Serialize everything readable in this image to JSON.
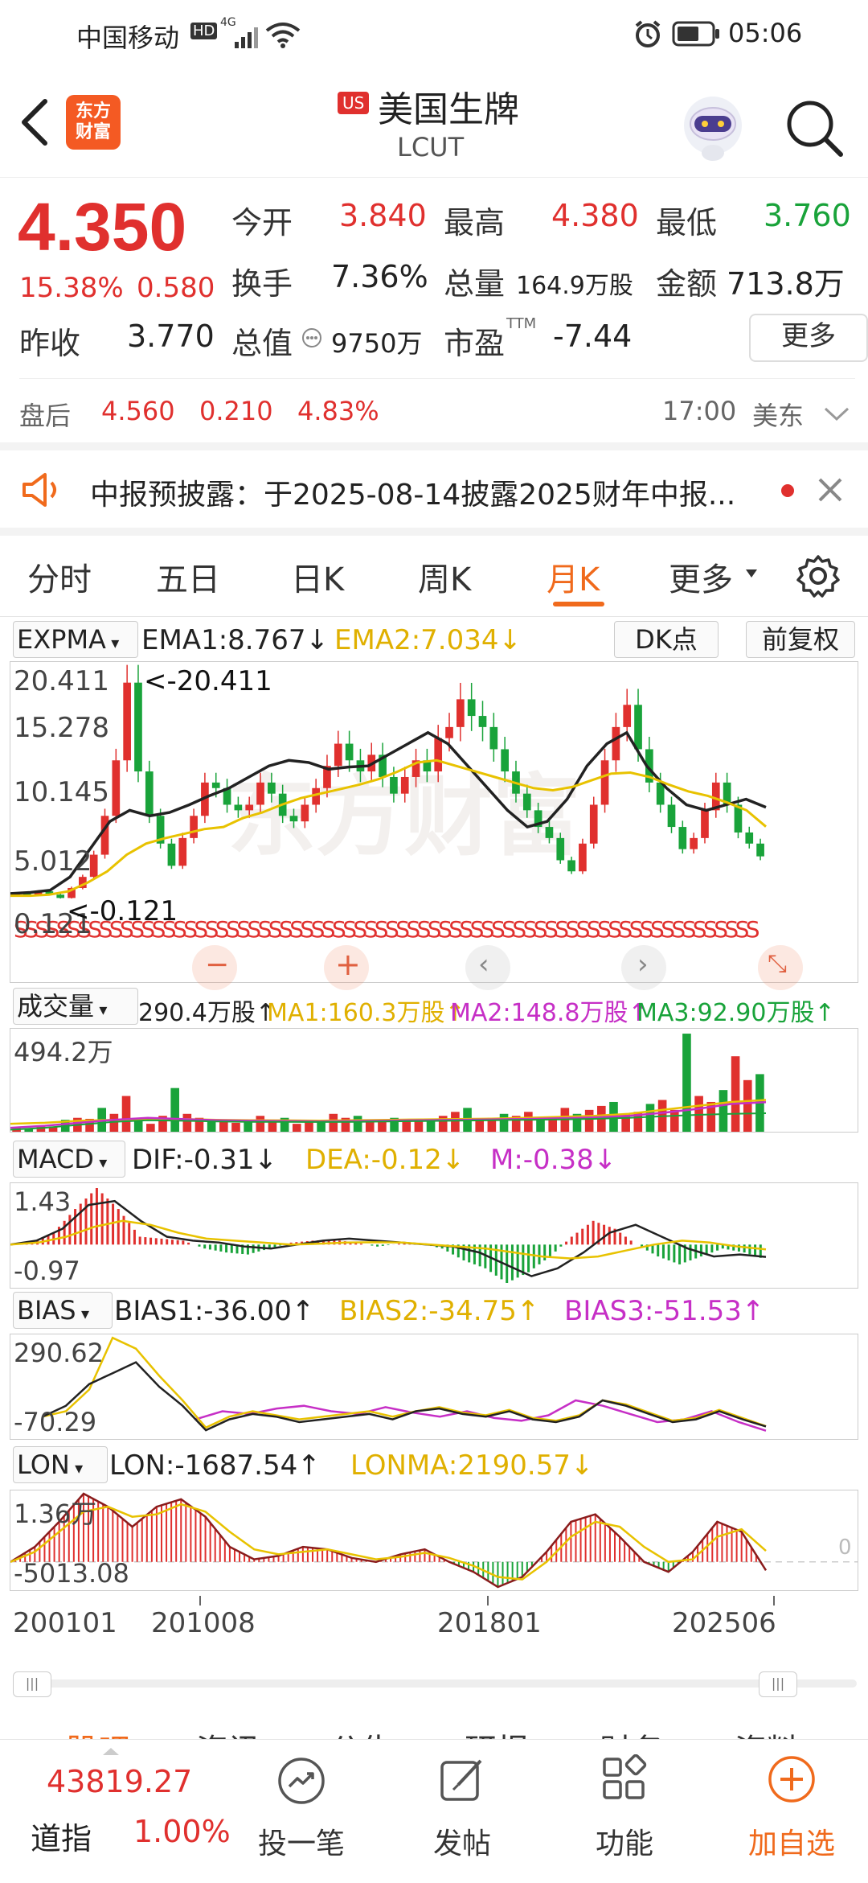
{
  "status_bar": {
    "carrier": "中国移动",
    "hd": "HD",
    "network": "4G",
    "time": "05:06"
  },
  "header": {
    "back_icon": "chevron-left-icon",
    "app_logo_line1": "东方",
    "app_logo_line2": "财富",
    "market_tag": "US",
    "stock_name": "美国生牌",
    "ticker": "LCUT"
  },
  "quote": {
    "price": "4.350",
    "change_pct": "15.38%",
    "change": "0.580",
    "open_label": "今开",
    "open": "3.840",
    "high_label": "最高",
    "high": "4.380",
    "low_label": "最低",
    "low": "3.760",
    "turnover_label": "换手",
    "turnover": "7.36%",
    "volume_label": "总量",
    "volume": "164.9万股",
    "amount_label": "金额",
    "amount": "713.8万",
    "prev_close_label": "昨收",
    "prev_close": "3.770",
    "mktcap_label": "总值",
    "mktcap": "9750万",
    "pe_label": "市盈",
    "pe_sup": "TTM",
    "pe": "-7.44",
    "more": "更多"
  },
  "after_hours": {
    "label": "盘后",
    "price": "4.560",
    "change": "0.210",
    "pct": "4.83%",
    "time": "17:00",
    "zone": "美东"
  },
  "notice": {
    "text": "中报预披露：于2025-08-14披露2025财年中报..."
  },
  "tabs": [
    "分时",
    "五日",
    "日K",
    "周K",
    "月K",
    "更多"
  ],
  "active_tab": 4,
  "main_chart": {
    "indicator": "EXPMA",
    "ema1": "EMA1:8.767↓",
    "ema2": "EMA2:7.034↓",
    "dk": "DK点",
    "adjust": "前复权",
    "y_labels": [
      "20.411",
      "15.278",
      "10.145",
      "5.012",
      "0.121"
    ],
    "high_mark": "<-20.411",
    "low_mark": "<-0.121"
  },
  "volume_chart": {
    "indicator": "成交量",
    "value": "290.4万股↑",
    "ma1": "MA1:160.3万股↑",
    "ma2": "MA2:148.8万股↑",
    "ma3": "MA3:92.90万股↑",
    "y_label": "494.2万"
  },
  "macd_chart": {
    "indicator": "MACD",
    "dif": "DIF:-0.31↓",
    "dea": "DEA:-0.12↓",
    "m": "M:-0.38↓",
    "y_top": "1.43",
    "y_bottom": "-0.97"
  },
  "bias_chart": {
    "indicator": "BIAS",
    "bias1": "BIAS1:-36.00↑",
    "bias2": "BIAS2:-34.75↑",
    "bias3": "BIAS3:-51.53↑",
    "y_top": "290.62",
    "y_bottom": "-70.29"
  },
  "lon_chart": {
    "indicator": "LON",
    "lon": "LON:-1687.54↑",
    "lonma": "LONMA:2190.57↓",
    "y_top": "1.36万",
    "y_bottom": "-5013.08",
    "zero": "0"
  },
  "x_axis": [
    "200101",
    "201008",
    "201801",
    "202506"
  ],
  "bottom_tabs_partial": [
    "股吧",
    "资讯",
    "公告",
    "研报",
    "财务",
    "资料"
  ],
  "bottom_bar": {
    "index_value": "43819.27",
    "index_name": "道指",
    "index_pct": "1.00%",
    "items": [
      "投一笔",
      "发帖",
      "功能",
      "加自选"
    ]
  },
  "colors": {
    "up": "#e0302e",
    "down": "#19a33a",
    "accent": "#f06a1c",
    "ema1": "#222222",
    "ema2": "#e8c200",
    "ma2": "#c62fc6"
  },
  "chart_data": [
    {
      "type": "candlestick",
      "title": "LCUT 月K",
      "x_ticks": [
        "200101",
        "201008",
        "201801",
        "202506"
      ],
      "ylim": [
        0.121,
        20.411
      ],
      "y_ticks": [
        20.411,
        15.278,
        10.145,
        5.012,
        0.121
      ],
      "series": [
        {
          "name": "Close",
          "values": [
            1.0,
            0.8,
            1.2,
            0.9,
            0.6,
            1.5,
            2.5,
            4.5,
            8.0,
            13.0,
            20.0,
            12.0,
            8.0,
            5.5,
            3.5,
            6.0,
            8.0,
            11.0,
            10.5,
            9.0,
            8.5,
            9.0,
            11.0,
            10.0,
            8.0,
            7.5,
            9.0,
            10.5,
            12.5,
            14.5,
            13.0,
            12.0,
            13.5,
            11.5,
            10.0,
            11.5,
            13.0,
            12.0,
            15.0,
            16.0,
            18.5,
            17.0,
            16.0,
            14.0,
            12.0,
            10.0,
            8.5,
            7.0,
            6.0,
            4.0,
            3.0,
            5.5,
            9.0,
            13.0,
            16.0,
            18.0,
            14.0,
            11.0,
            9.0,
            7.0,
            5.0,
            6.0,
            8.5,
            11.0,
            9.0,
            6.5,
            5.5,
            4.35
          ]
        },
        {
          "name": "EMA1",
          "values": [
            1.0,
            1.1,
            1.3,
            2.5,
            5.0,
            7.5,
            8.5,
            8.0,
            8.3,
            9.0,
            9.8,
            10.5,
            11.5,
            12.5,
            13.0,
            12.8,
            12.2,
            12.4,
            12.5,
            13.5,
            14.5,
            15.5,
            14.5,
            12.5,
            10.5,
            8.5,
            7.0,
            7.5,
            9.5,
            12.5,
            14.5,
            15.5,
            12.5,
            10.5,
            9.0,
            8.5,
            9.0,
            9.5,
            8.77
          ]
        },
        {
          "name": "EMA2",
          "values": [
            0.8,
            0.8,
            0.9,
            1.2,
            2.0,
            3.0,
            4.5,
            5.5,
            6.0,
            6.4,
            6.8,
            7.0,
            7.8,
            8.3,
            9.0,
            9.6,
            10.0,
            10.4,
            10.8,
            11.3,
            12.0,
            12.8,
            13.0,
            12.5,
            12.0,
            11.5,
            11.0,
            10.5,
            10.3,
            10.6,
            11.2,
            11.8,
            11.9,
            11.5,
            10.8,
            10.2,
            9.8,
            9.2,
            8.5,
            7.03
          ]
        }
      ]
    },
    {
      "type": "bar",
      "title": "成交量",
      "ylim": [
        0,
        494.2
      ],
      "series": [
        {
          "name": "成交量",
          "values": [
            20,
            15,
            30,
            25,
            60,
            70,
            65,
            120,
            90,
            180,
            60,
            40,
            80,
            220,
            90,
            70,
            50,
            60,
            45,
            60,
            80,
            55,
            70,
            40,
            50,
            60,
            90,
            70,
            80,
            60,
            50,
            70,
            60,
            55,
            65,
            80,
            100,
            120,
            60,
            70,
            90,
            80,
            100,
            70,
            60,
            120,
            90,
            110,
            130,
            150,
            90,
            100,
            140,
            160,
            110,
            494,
            180,
            150,
            210,
            380,
            260,
            290
          ]
        },
        {
          "name": "MA1",
          "values": [
            40,
            45,
            55,
            60,
            62,
            64,
            60,
            58,
            57,
            56,
            58,
            60,
            62,
            64,
            66,
            70,
            75,
            80,
            90,
            110,
            130,
            150,
            160
          ]
        },
        {
          "name": "MA2",
          "values": [
            20,
            30,
            45,
            60,
            70,
            64,
            58,
            55,
            54,
            52,
            54,
            56,
            58,
            60,
            62,
            64,
            68,
            72,
            80,
            95,
            115,
            140,
            149
          ]
        },
        {
          "name": "MA3",
          "values": [
            10,
            20,
            35,
            50,
            58,
            55,
            52,
            50,
            50,
            49,
            50,
            52,
            54,
            56,
            58,
            60,
            62,
            65,
            70,
            78,
            85,
            90,
            93
          ]
        }
      ]
    },
    {
      "type": "bar",
      "title": "MACD",
      "ylim": [
        -0.97,
        1.43
      ],
      "series": [
        {
          "name": "M",
          "values": [
            0,
            0.05,
            0.3,
            0.9,
            1.43,
            0.9,
            0.2,
            0.15,
            0.1,
            -0.1,
            -0.2,
            -0.25,
            -0.1,
            0.05,
            0.1,
            0.12,
            0.05,
            -0.05,
            0.02,
            0.03,
            -0.1,
            -0.4,
            -0.6,
            -0.97,
            -0.7,
            -0.3,
            0.2,
            0.6,
            0.4,
            0.0,
            -0.3,
            -0.5,
            -0.3,
            -0.1,
            -0.2,
            -0.38
          ]
        },
        {
          "name": "DIF",
          "values": [
            0,
            0.1,
            0.4,
            1.0,
            1.1,
            0.6,
            0.2,
            0.1,
            0.05,
            -0.05,
            -0.1,
            0.0,
            0.1,
            0.15,
            0.1,
            0.05,
            0.0,
            -0.05,
            -0.2,
            -0.5,
            -0.8,
            -0.6,
            -0.2,
            0.3,
            0.5,
            0.2,
            -0.1,
            -0.3,
            -0.25,
            -0.31
          ]
        },
        {
          "name": "DEA",
          "values": [
            0,
            0.05,
            0.2,
            0.45,
            0.6,
            0.5,
            0.3,
            0.15,
            0.1,
            0.05,
            0.0,
            0.02,
            0.05,
            0.06,
            0.05,
            0.0,
            -0.05,
            -0.1,
            -0.2,
            -0.3,
            -0.35,
            -0.3,
            -0.15,
            0.0,
            0.1,
            0.05,
            -0.05,
            -0.12
          ]
        }
      ]
    },
    {
      "type": "line",
      "title": "BIAS",
      "ylim": [
        -70.29,
        290.62
      ],
      "series": [
        {
          "name": "BIAS1",
          "values": [
            0,
            40,
            120,
            160,
            200,
            110,
            40,
            -50,
            -10,
            10,
            0,
            -20,
            -10,
            0,
            10,
            -10,
            20,
            30,
            10,
            0,
            20,
            -10,
            -20,
            0,
            60,
            40,
            10,
            -20,
            -10,
            20,
            -10,
            -36
          ]
        },
        {
          "name": "BIAS2",
          "values": [
            0,
            20,
            100,
            290,
            250,
            150,
            60,
            -40,
            0,
            20,
            5,
            -10,
            0,
            10,
            20,
            0,
            20,
            35,
            15,
            5,
            25,
            -5,
            -15,
            5,
            60,
            45,
            15,
            -15,
            -5,
            25,
            -5,
            -34.75
          ]
        },
        {
          "name": "BIAS3",
          "values": [
            -10,
            20,
            10,
            30,
            40,
            20,
            10,
            35,
            15,
            0,
            20,
            -5,
            -15,
            5,
            60,
            40,
            10,
            -20,
            -10,
            20,
            -20,
            -51.53
          ]
        }
      ]
    },
    {
      "type": "area",
      "title": "LON",
      "ylim": [
        -5013.08,
        13600
      ],
      "series": [
        {
          "name": "LON",
          "values": [
            0,
            3000,
            8000,
            13600,
            11000,
            7000,
            11000,
            12500,
            9000,
            3000,
            500,
            1200,
            3000,
            2500,
            800,
            0,
            1500,
            2500,
            0,
            -2000,
            -5013,
            -3000,
            2000,
            8000,
            9500,
            5000,
            0,
            -2000,
            2000,
            8000,
            6000,
            -1687.54
          ]
        },
        {
          "name": "LONMA",
          "values": [
            0,
            2000,
            6000,
            10000,
            11000,
            9000,
            9500,
            11500,
            10000,
            6000,
            2500,
            1500,
            2000,
            2500,
            1500,
            500,
            1000,
            1800,
            800,
            -800,
            -3000,
            -3500,
            0,
            5000,
            8000,
            7000,
            3000,
            0,
            500,
            5000,
            6500,
            2190.57
          ]
        }
      ]
    }
  ]
}
